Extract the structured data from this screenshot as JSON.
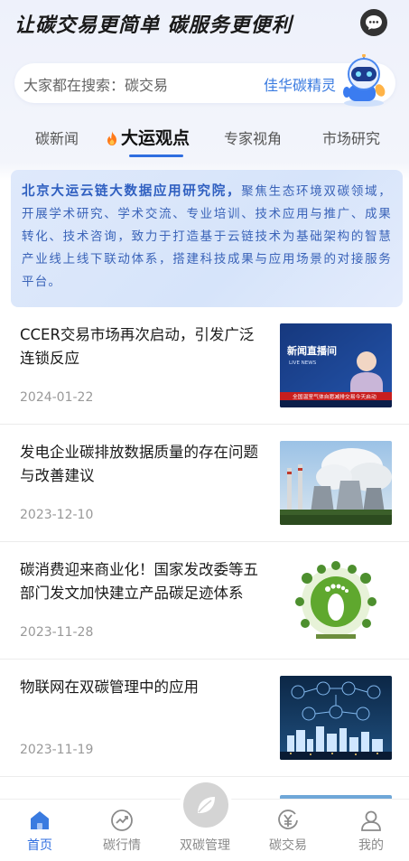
{
  "header": {
    "slogan": "让碳交易更简单 碳服务更便利",
    "message_icon": "chat-bubble-icon"
  },
  "search": {
    "placeholder": "大家都在搜索：碳交易",
    "assistant_label": "佳华碳精灵",
    "assistant_icon": "robot-icon"
  },
  "tabs": [
    {
      "label": "碳新闻",
      "active": false
    },
    {
      "label": "大运观点",
      "active": true,
      "icon": "fire-icon"
    },
    {
      "label": "专家视角",
      "active": false
    },
    {
      "label": "市场研究",
      "active": false
    }
  ],
  "intro": {
    "org": "北京大运云链大数据应用研究院，",
    "body": "聚焦生态环境双碳领域，开展学术研究、学术交流、专业培训、技术应用与推广、成果转化、技术咨询，致力于打造基于云链技术为基础架构的智慧产业线上线下联动体系，搭建科技成果与应用场景的对接服务平台。"
  },
  "news": [
    {
      "title": "CCER交易市场再次启动，引发广泛连锁反应",
      "date": "2024-01-22",
      "thumb": "news-broadcast-image",
      "thumb_caption": "新闻直播间",
      "thumb_subcaption": "LIVE NEWS",
      "thumb_ticker": "全国温室气体自愿减排交易今天启动"
    },
    {
      "title": "发电企业碳排放数据质量的存在问题与改善建议",
      "date": "2023-12-10",
      "thumb": "power-plant-image"
    },
    {
      "title": "碳消费迎来商业化！国家发改委等五部门发文加快建立产品碳足迹体系",
      "date": "2023-11-28",
      "thumb": "carbon-footprint-image"
    },
    {
      "title": "物联网在双碳管理中的应用",
      "date": "2023-11-19",
      "thumb": "iot-city-image"
    }
  ],
  "bottom_nav": [
    {
      "label": "首页",
      "icon": "home-icon",
      "active": true
    },
    {
      "label": "碳行情",
      "icon": "trend-icon",
      "active": false
    },
    {
      "label": "双碳管理",
      "icon": "leaf-icon",
      "active": false
    },
    {
      "label": "碳交易",
      "icon": "yen-coin-icon",
      "active": false
    },
    {
      "label": "我的",
      "icon": "user-icon",
      "active": false
    }
  ],
  "colors": {
    "accent": "#2f6ee0",
    "intro_text": "#3a63b8",
    "date": "#999999"
  }
}
